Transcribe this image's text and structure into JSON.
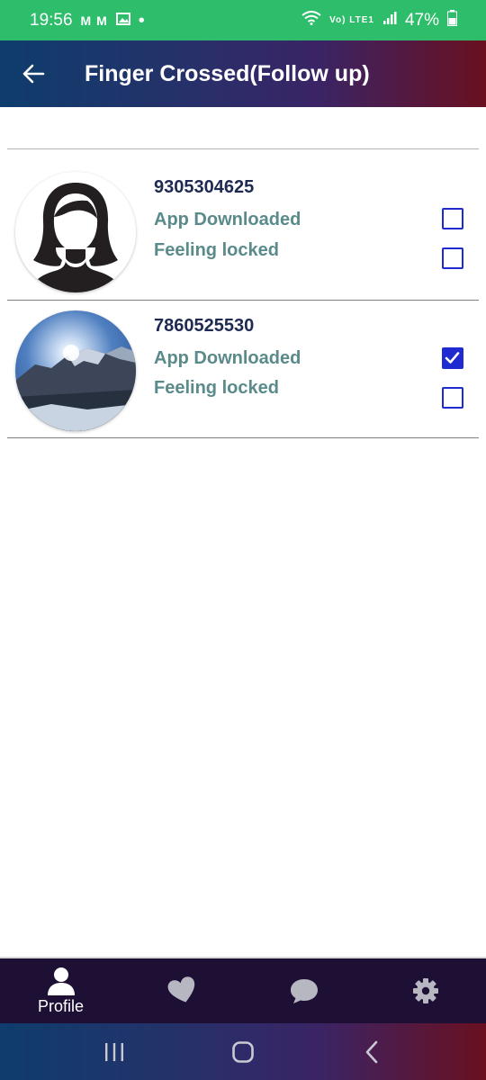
{
  "status_bar": {
    "time": "19:56",
    "notif_icons": "M M",
    "network": "Vo) LTE1",
    "battery": "47%"
  },
  "app_bar": {
    "title": "Finger Crossed(Follow up)"
  },
  "contacts": [
    {
      "phone": "9305304625",
      "option_a": "App Downloaded",
      "option_b": "Feeling locked",
      "option_a_checked": false,
      "option_b_checked": false,
      "avatar_icon": "female-silhouette-icon"
    },
    {
      "phone": "7860525530",
      "option_a": "App Downloaded",
      "option_b": "Feeling locked",
      "option_a_checked": true,
      "option_b_checked": false,
      "avatar_icon": "mountain-photo"
    }
  ],
  "bottom_nav": {
    "items": [
      {
        "label": "Profile",
        "icon": "person-icon"
      },
      {
        "label": "",
        "icon": "heart-icon"
      },
      {
        "label": "",
        "icon": "chat-bubble-icon"
      },
      {
        "label": "",
        "icon": "gear-icon"
      }
    ]
  },
  "colors": {
    "status_bar": "#2ebd6b",
    "header_gradient_start": "#0e3d6d",
    "header_gradient_end": "#6a1020",
    "phone_text": "#1e2a52",
    "option_text": "#5a8a8a",
    "checkbox": "#1f2bd1",
    "bottom_nav": "#1e0f35"
  }
}
